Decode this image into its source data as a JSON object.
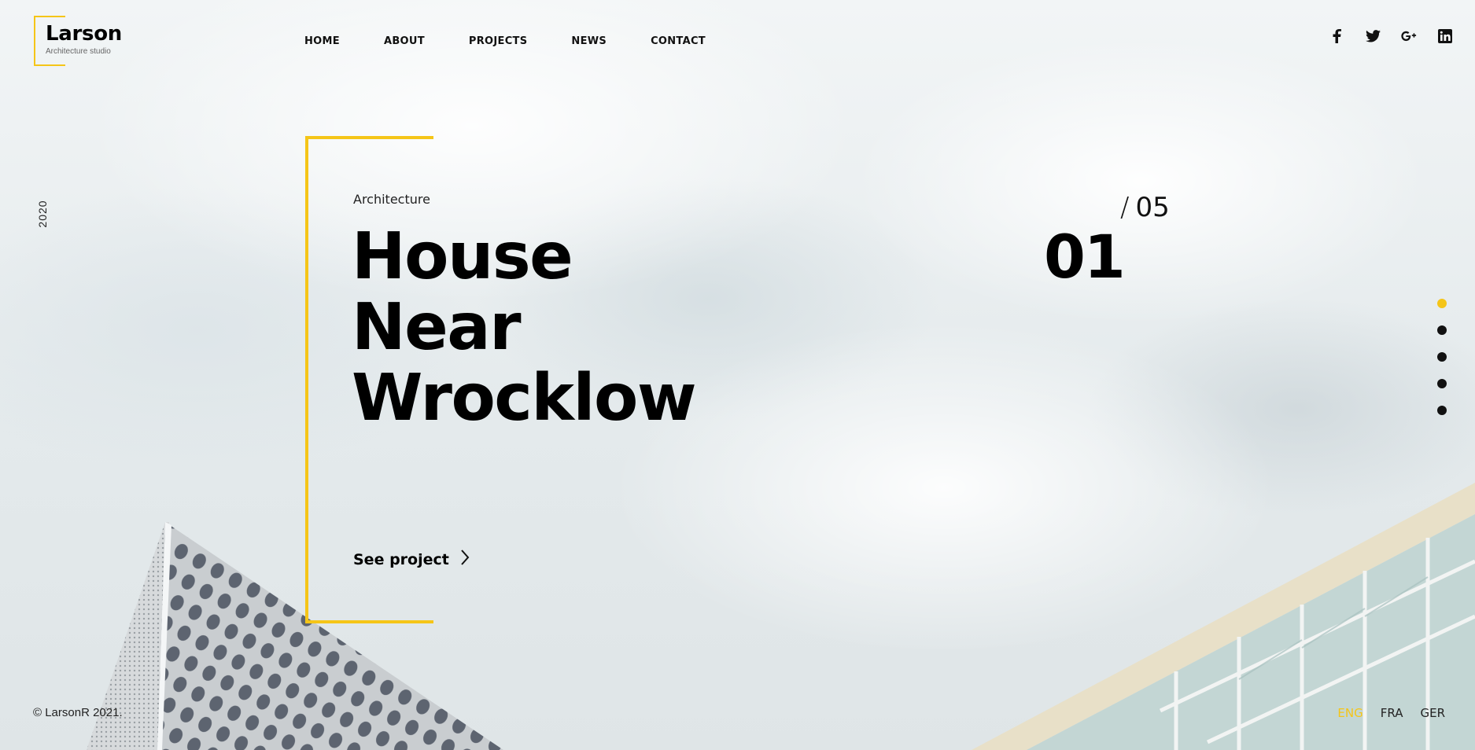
{
  "brand": {
    "name": "Larson",
    "tagline": "Architecture studio",
    "accent": "#f5c518"
  },
  "nav": {
    "items": [
      {
        "label": "HOME"
      },
      {
        "label": "ABOUT"
      },
      {
        "label": "PROJECTS"
      },
      {
        "label": "NEWS"
      },
      {
        "label": "CONTACT"
      }
    ]
  },
  "social": [
    "facebook-icon",
    "twitter-icon",
    "google-plus-icon",
    "linkedin-icon"
  ],
  "sidebar": {
    "year": "2020"
  },
  "hero": {
    "category": "Architecture",
    "title_lines": [
      "House",
      "Near",
      "Wrocklow"
    ],
    "cta": "See project"
  },
  "counter": {
    "current": "01",
    "total": "05"
  },
  "slider": {
    "count": 5,
    "active_index": 0
  },
  "footer": {
    "copyright": "© LarsonR 2021.",
    "languages": [
      {
        "label": "ENG",
        "active": true
      },
      {
        "label": "FRA",
        "active": false
      },
      {
        "label": "GER",
        "active": false
      }
    ]
  }
}
